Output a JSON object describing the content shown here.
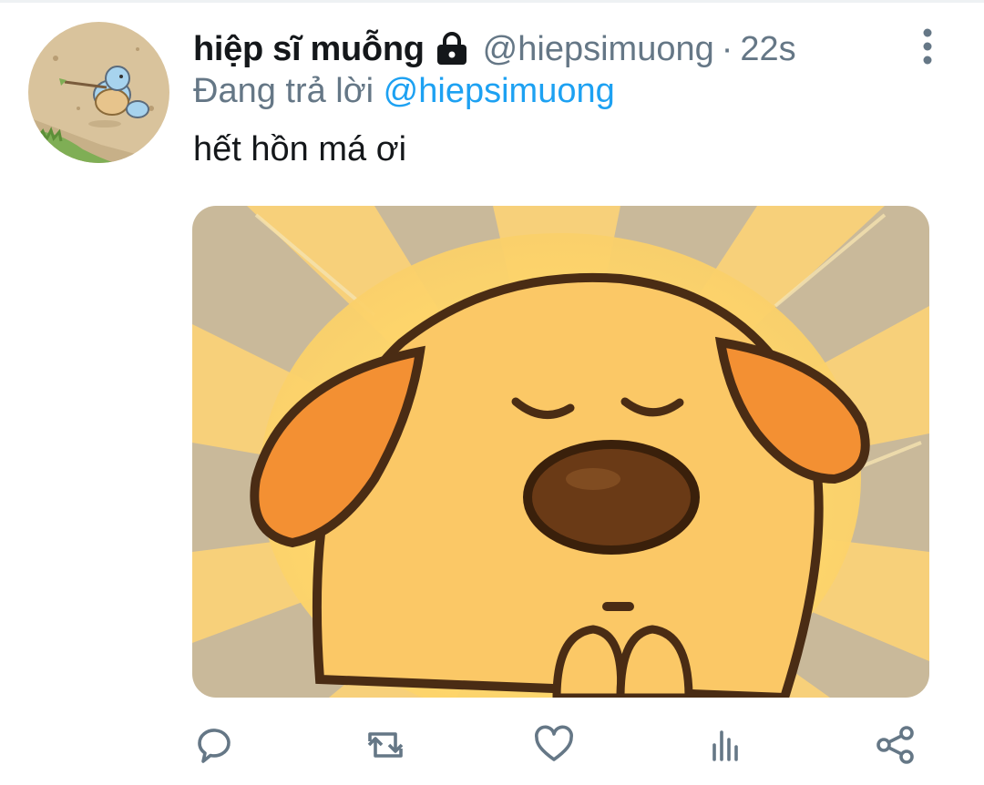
{
  "tweet": {
    "display_name": "hiệp sĩ muỗng",
    "handle": "@hiepsimuong",
    "separator": "·",
    "time": "22s",
    "reply_prefix": "Đang trả lời",
    "reply_to": "@hiepsimuong",
    "text": "hết hồn má ơi",
    "protected_icon": "lock-icon",
    "more_icon": "vertical-ellipsis-icon"
  },
  "actions": [
    {
      "name": "reply",
      "icon": "reply-icon"
    },
    {
      "name": "retweet",
      "icon": "retweet-icon"
    },
    {
      "name": "like",
      "icon": "heart-icon"
    },
    {
      "name": "analytics",
      "icon": "analytics-icon"
    },
    {
      "name": "share",
      "icon": "share-icon"
    }
  ],
  "colors": {
    "text": "#14171a",
    "secondary": "#657786",
    "link": "#1da1f2"
  }
}
